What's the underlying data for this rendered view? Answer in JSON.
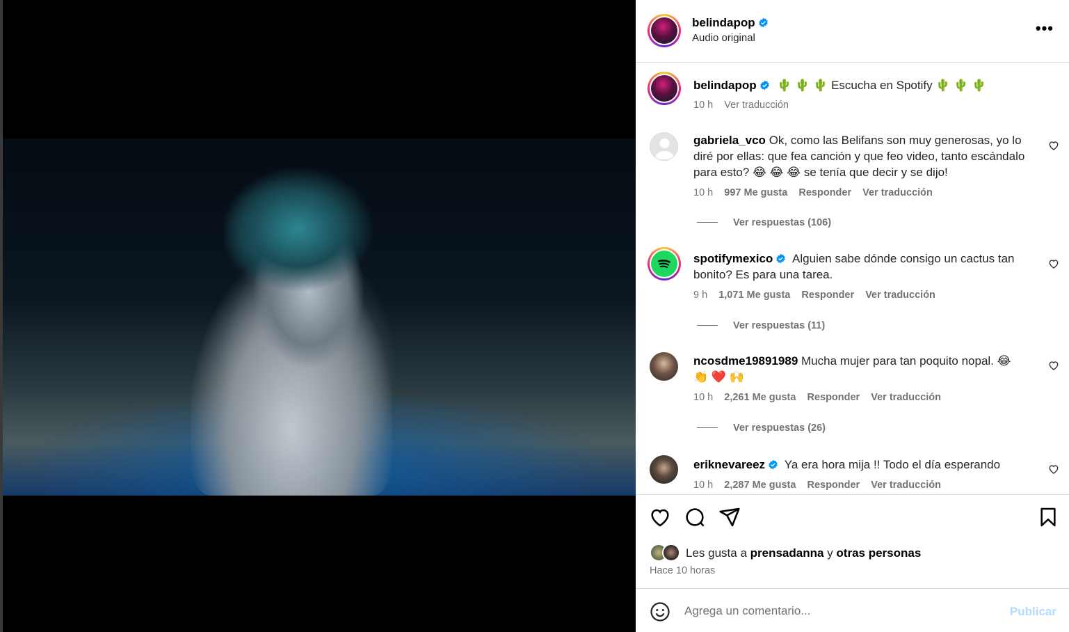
{
  "post": {
    "author": "belindapop",
    "audio": "Audio original",
    "caption_text": "🌵 🌵 🌵 Escucha en Spotify 🌵 🌵 🌵",
    "caption_time": "10 h",
    "caption_translate": "Ver traducción"
  },
  "comments": [
    {
      "user": "gabriela_vco",
      "text": "Ok, como las Belifans son muy generosas, yo lo diré por ellas: que fea canción y que feo video, tanto escándalo para esto? 😂 😂 😂 se tenía que decir y se dijo!",
      "time": "10 h",
      "likes": "997 Me gusta",
      "reply": "Responder",
      "translate": "Ver traducción",
      "replies": "Ver respuestas (106)"
    },
    {
      "user": "spotifymexico",
      "text": "Alguien sabe dónde consigo un cactus tan bonito? Es para una tarea.",
      "time": "9 h",
      "likes": "1,071 Me gusta",
      "reply": "Responder",
      "translate": "Ver traducción",
      "replies": "Ver respuestas (11)"
    },
    {
      "user": "ncosdme19891989",
      "text": "Mucha mujer para tan poquito nopal. 😂 👏 ❤️ 🙌",
      "time": "10 h",
      "likes": "2,261 Me gusta",
      "reply": "Responder",
      "translate": "Ver traducción",
      "replies": "Ver respuestas (26)"
    },
    {
      "user": "eriknevareez",
      "text": "Ya era hora mija !! Todo el día esperando",
      "time": "10 h",
      "likes": "2,287 Me gusta",
      "reply": "Responder",
      "translate": "Ver traducción"
    }
  ],
  "likes_line": {
    "prefix": "Les gusta a",
    "user": "prensadanna",
    "conj": "y",
    "others": "otras personas"
  },
  "posted_time": "Hace 10 horas",
  "composer": {
    "placeholder": "Agrega un comentario...",
    "publish": "Publicar"
  },
  "colors": {
    "verified": "#0095f6",
    "publish_disabled": "#b3dbff",
    "spotify": "#1ed760"
  },
  "icons": [
    "volume-icon",
    "more-icon",
    "verified-icon",
    "heart-icon",
    "comment-icon",
    "share-icon",
    "bookmark-icon",
    "emoji-icon"
  ]
}
